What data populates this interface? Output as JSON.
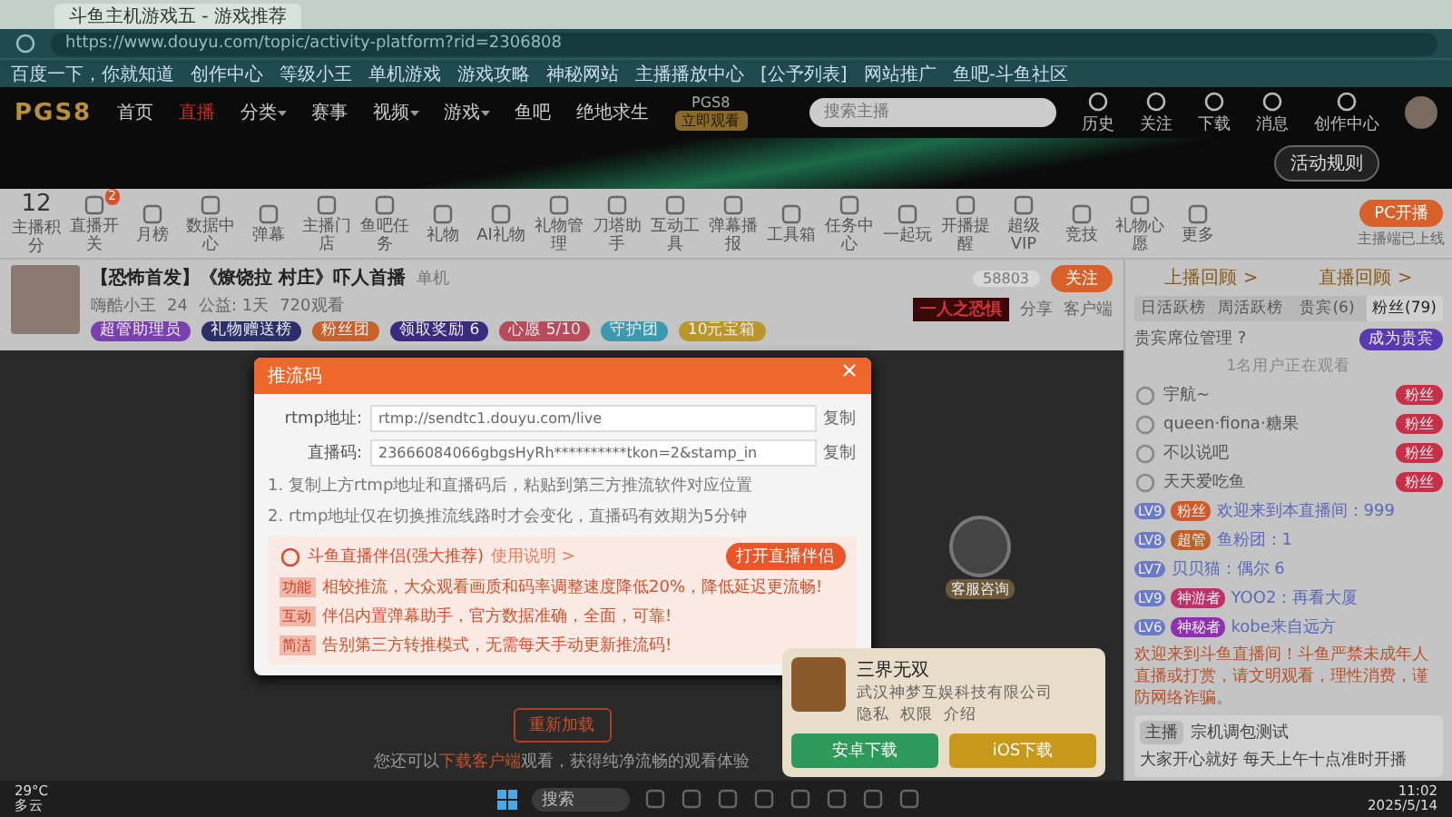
{
  "browser": {
    "tab_title": "斗鱼主机游戏五 - 游戏推荐",
    "address": "https://www.douyu.com/topic/activity-platform?rid=2306808",
    "bookmarks": [
      "百度一下，你就知道",
      "创作中心",
      "等级小王",
      "单机游戏",
      "游戏攻略",
      "神秘网站",
      "主播播放中心",
      "[公予列表]",
      "网站推广",
      "鱼吧-斗鱼社区"
    ]
  },
  "site_header": {
    "logo": "PGS8",
    "nav": [
      {
        "label": "首页",
        "selected": false,
        "has_menu": false
      },
      {
        "label": "直播",
        "selected": true,
        "has_menu": false
      },
      {
        "label": "分类",
        "selected": false,
        "has_menu": true
      },
      {
        "label": "赛事",
        "selected": false,
        "has_menu": false
      },
      {
        "label": "视频",
        "selected": false,
        "has_menu": true
      },
      {
        "label": "游戏",
        "selected": false,
        "has_menu": true
      },
      {
        "label": "鱼吧",
        "selected": false,
        "has_menu": false
      },
      {
        "label": "绝地求生",
        "selected": false,
        "has_menu": false
      }
    ],
    "event_label": "PGS8",
    "event_button": "立即观看",
    "search_placeholder": "搜索主播",
    "user_links": [
      "历史",
      "关注",
      "下载",
      "消息",
      "创作中心"
    ]
  },
  "banner": {
    "button": "活动规则"
  },
  "toolbar": {
    "score": "12",
    "score_label": "主播积分",
    "items": [
      {
        "label": "直播开关",
        "badge": "2"
      },
      {
        "label": "月榜"
      },
      {
        "label": "数据中心"
      },
      {
        "label": "弹幕"
      },
      {
        "label": "主播门店"
      },
      {
        "label": "鱼吧任务"
      },
      {
        "label": "礼物"
      },
      {
        "label": "AI礼物"
      },
      {
        "label": "礼物管理"
      },
      {
        "label": "刀塔助手"
      },
      {
        "label": "互动工具"
      },
      {
        "label": "弹幕播报"
      },
      {
        "label": "工具箱"
      },
      {
        "label": "任务中心"
      },
      {
        "label": "一起玩"
      },
      {
        "label": "开播提醒"
      },
      {
        "label": "超级VIP"
      },
      {
        "label": "竞技"
      },
      {
        "label": "礼物心愿"
      },
      {
        "label": "更多"
      }
    ],
    "pc_button": "PC开播",
    "pc_note": "主播端已上线"
  },
  "streamer": {
    "title": "【恐怖首发】《燎饶拉 村庄》吓人首播",
    "category": "单机",
    "stats": [
      "嗨酷小王",
      "24",
      "公益: 1天",
      "720观看"
    ],
    "badges": [
      {
        "label": "超管助理员",
        "color": "#7a3fb0"
      },
      {
        "label": "礼物赠送榜",
        "color": "#2d2f6b"
      },
      {
        "label": "粉丝团",
        "color": "#c8612a"
      },
      {
        "label": "领取奖励 6",
        "color": "#3a2a80"
      },
      {
        "label": "心愿 5/10",
        "color": "#b84a5a"
      },
      {
        "label": "守护团",
        "color": "#3a9ab0"
      },
      {
        "label": "10元宝箱",
        "color": "#b8962a"
      }
    ],
    "follow_count": "58803",
    "follow": "关注",
    "share": "分享",
    "client": "客户端",
    "ad_text": "一人之恐惧"
  },
  "dialog": {
    "title": "推流码",
    "fields": [
      {
        "label": "rtmp地址:",
        "value": "rtmp://sendtc1.douyu.com/live",
        "copy": "复制"
      },
      {
        "label": "直播码:",
        "value": "23666084066gbgsHyRh**********tkon=2&stamp_in",
        "copy": "复制"
      }
    ],
    "notes": [
      "1. 复制上方rtmp地址和直播码后，粘贴到第三方推流软件对应位置",
      "2. rtmp地址仅在切换推流线路时才会变化，直播码有效期为5分钟"
    ],
    "promo": {
      "title": "斗鱼直播伴侣(强大推荐)",
      "link": "使用说明 >",
      "button": "打开直播伴侣",
      "rows": [
        {
          "tag": "功能",
          "text": "相较推流，大众观看画质和码率调整速度降低20%，降低延迟更流畅!"
        },
        {
          "tag": "互动",
          "text": "伴侣内置弹幕助手，官方数据准确，全面，可靠!"
        },
        {
          "tag": "简洁",
          "text": "告别第三方转推模式，无需每天手动更新推流码!"
        }
      ]
    }
  },
  "player": {
    "reload": "重新加载",
    "hint_before": "您还可以",
    "hint_link": "下载客户端",
    "hint_after": "观看，获得纯净流畅的观看体验"
  },
  "game_card": {
    "name": "三界无双",
    "company": "武汉神梦互娱科技有限公司",
    "links": [
      "隐私",
      "权限",
      "介绍"
    ],
    "android": "安卓下载",
    "ios": "iOS下载"
  },
  "chat": {
    "links": [
      "上播回顾 >",
      "直播回顾 >"
    ],
    "tabs": [
      {
        "label": "日活跃榜",
        "selected": false
      },
      {
        "label": "周活跃榜",
        "selected": false
      },
      {
        "label": "贵宾(6)",
        "selected": false
      },
      {
        "label": "粉丝(79)",
        "selected": true
      }
    ],
    "vip_label": "贵宾席位管理 ?",
    "vip_button": "成为贵宾",
    "watch_note": "1名用户正在观看",
    "ranks": [
      {
        "name": "宇航~",
        "badge": "粉丝"
      },
      {
        "name": "queen·fiona·糖果",
        "badge": "粉丝"
      },
      {
        "name": "不以说吧",
        "badge": "粉丝"
      },
      {
        "name": "天天爱吃鱼",
        "badge": "粉丝"
      }
    ],
    "messages": [
      {
        "level": "LV9",
        "badge": "粉丝",
        "color": "#d05a2a",
        "text": "欢迎来到本直播间：999"
      },
      {
        "level": "LV8",
        "badge": "超管",
        "color": "#c0602a",
        "text": "鱼粉团：1"
      },
      {
        "level": "LV7",
        "text": "贝贝猫：偶尔 6"
      },
      {
        "level": "LV9",
        "badge": "神游者",
        "color": "#c0306a",
        "text": "YOO2：再看大厦"
      },
      {
        "level": "LV6",
        "badge": "神秘者",
        "color": "#9030b0",
        "text": "kobe来自远方"
      }
    ],
    "notice": "欢迎来到斗鱼直播间！斗鱼严禁未成年人直播或打赏，请文明观看，理性消费，谨防网络诈骗。",
    "host": {
      "role": "主播",
      "tag": "宗机调包测试",
      "text": "大家开心就好 每天上午十点准时开播"
    },
    "support": "客服咨询"
  },
  "taskbar": {
    "temp": "29°C",
    "weather": "多云",
    "search": "搜索",
    "time": "11:02",
    "date": "2025/5/14"
  }
}
